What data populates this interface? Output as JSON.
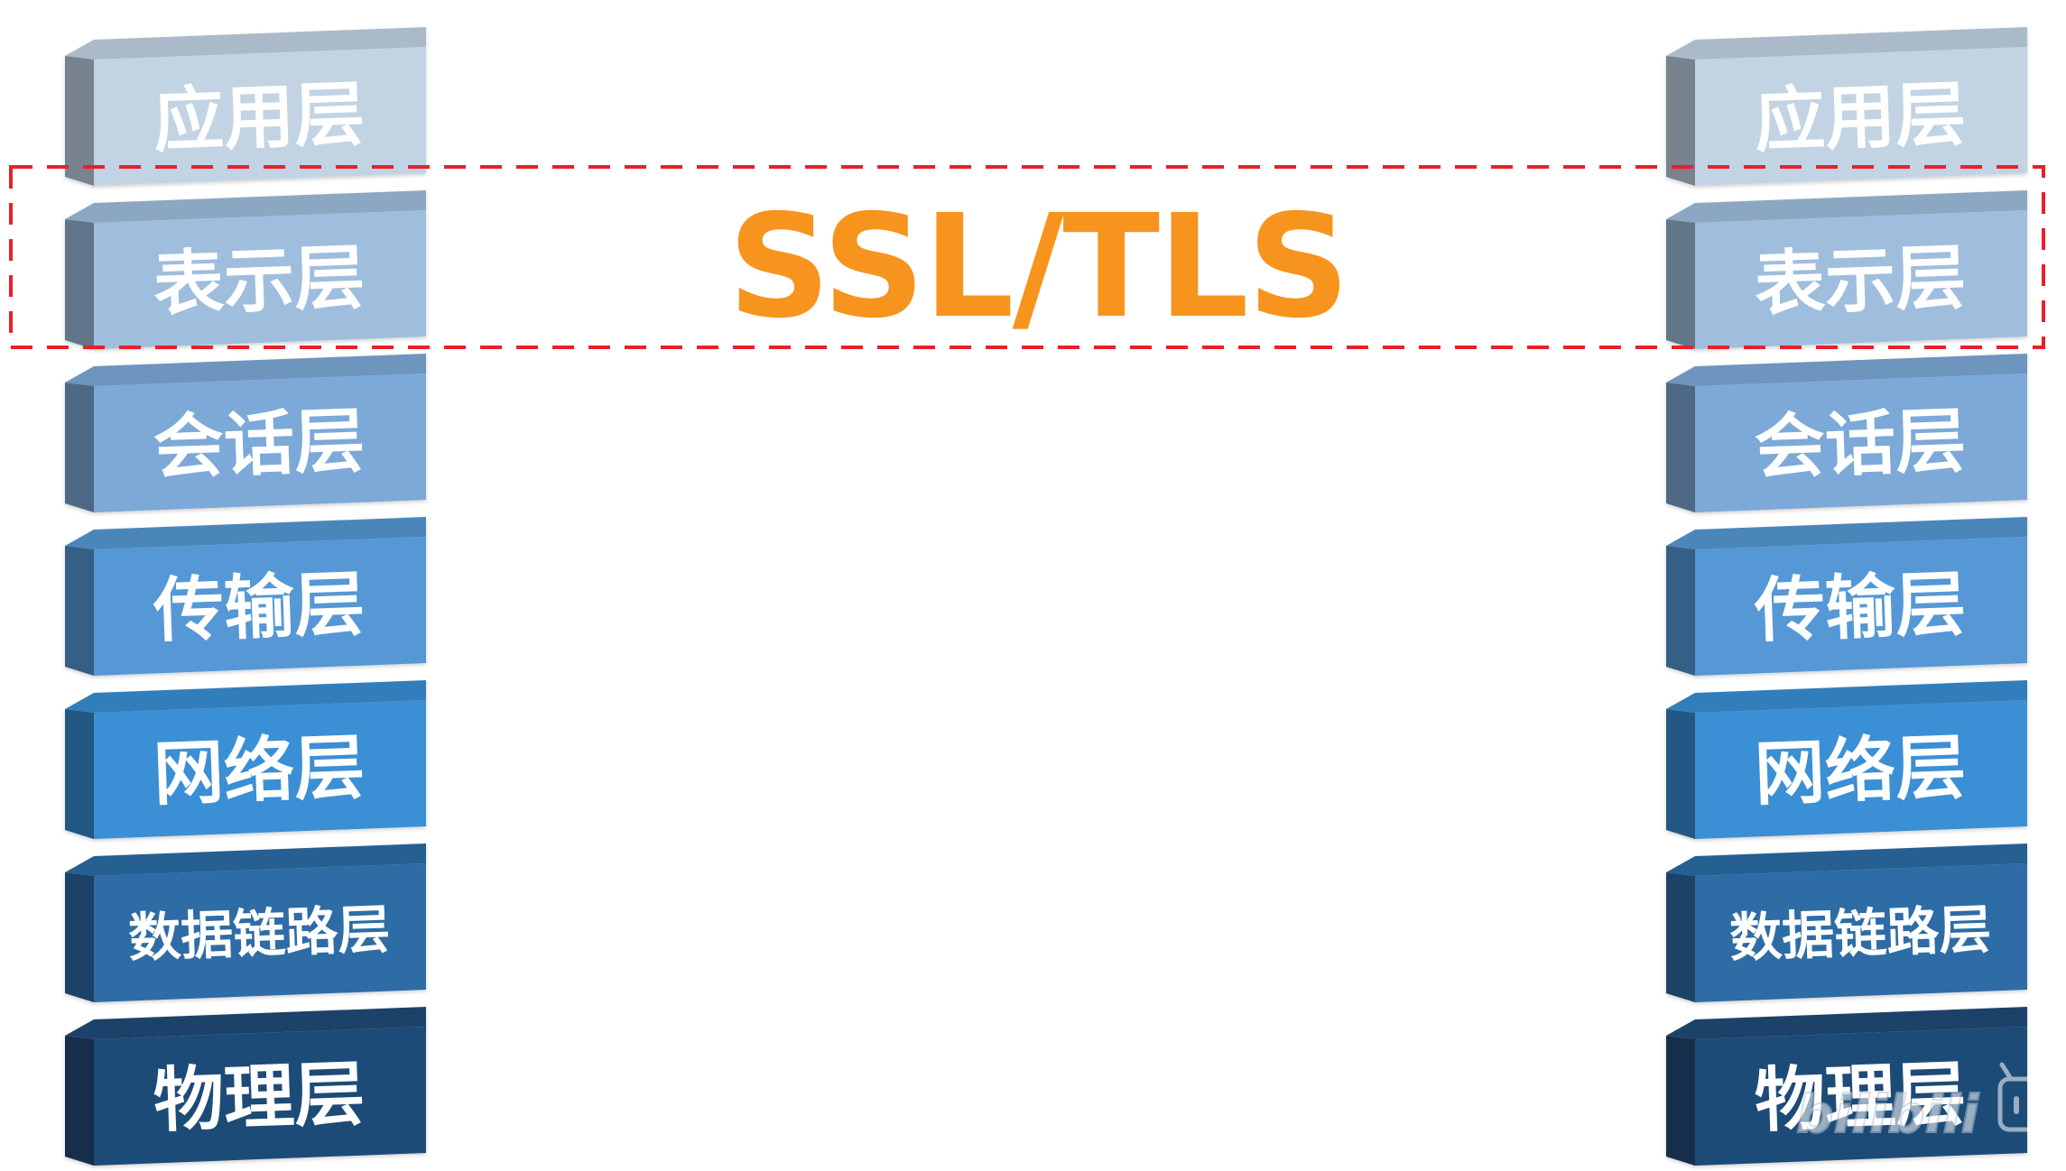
{
  "stacks": {
    "left": {
      "layers": [
        {
          "label": "应用层",
          "color": "#C2D3E4"
        },
        {
          "label": "表示层",
          "color": "#9FBEDD"
        },
        {
          "label": "会话层",
          "color": "#7CA9D7"
        },
        {
          "label": "传输层",
          "color": "#5598D5"
        },
        {
          "label": "网络层",
          "color": "#3A8FD4"
        },
        {
          "label": "数据链路层",
          "color": "#2E6CA6"
        },
        {
          "label": "物理层",
          "color": "#1F4C77"
        }
      ]
    },
    "right": {
      "layers": [
        {
          "label": "应用层",
          "color": "#C2D3E4"
        },
        {
          "label": "表示层",
          "color": "#9FBEDD"
        },
        {
          "label": "会话层",
          "color": "#7CA9D7"
        },
        {
          "label": "传输层",
          "color": "#5598D5"
        },
        {
          "label": "网络层",
          "color": "#3A8FD4"
        },
        {
          "label": "数据链路层",
          "color": "#2E6CA6"
        },
        {
          "label": "物理层",
          "color": "#1F4C77"
        }
      ]
    }
  },
  "highlight": {
    "protocol_label": "SSL/TLS",
    "protocol_color": "#F7941D",
    "border_color": "#E8202A",
    "spans_layer": "表示层"
  },
  "watermark": {
    "text": "bilibili",
    "icon": "bilibili-tv-icon"
  }
}
